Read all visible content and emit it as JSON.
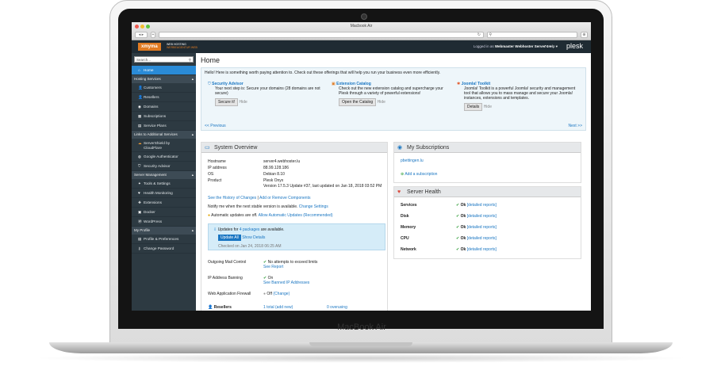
{
  "device": {
    "brand": "MacBook Air",
    "window_title": "Macbook Air"
  },
  "header": {
    "logo": "xmyma",
    "logo_sub1": "WEB HOSTING",
    "logo_sub2": "WERBEAGENTUR WEB",
    "logged_in": "Logged in as",
    "user": "Webmaster Webhoster Server 4",
    "help": "Help",
    "plesk": "plesk"
  },
  "sidebar": {
    "search_placeholder": "Search...",
    "home": "Home",
    "sec1": "Hosting Services",
    "customers": "Customers",
    "resellers": "Resellers",
    "domains": "Domains",
    "subscriptions": "Subscriptions",
    "plans": "Service Plans",
    "sec2": "Links to Additional Services",
    "serv1": "ServerShield by",
    "serv1b": "CloudFlare",
    "gauth": "Google Authenticator",
    "secadv": "Security Advisor",
    "sec3": "Server Management",
    "tools": "Tools & Settings",
    "health": "Health Monitoring",
    "ext": "Extensions",
    "docker": "Docker",
    "wp": "WordPress",
    "sec4": "My Profile",
    "profile": "Profile & Preferences",
    "pass": "Change Password"
  },
  "main": {
    "title": "Home",
    "promo_text": "Hello! Here is something worth paying attention to. Check out these offerings that will help you run your business even more efficiently.",
    "c1t": "Security Advisor",
    "c1d": "Your next step is: Secure your domains (28 domains are not secure)",
    "c1b": "Secure it!",
    "hide": "Hide",
    "c2t": "Extension Catalog",
    "c2d": "Check out the new extension catalog and supercharge your Plesk through a variety of powerful extensions!",
    "c2b": "Open the Catalog",
    "c3t": "Joomla! Toolkit",
    "c3d": "Joomla! Toolkit is a powerful Joomla! security and management tool that allows you to mass manage and secure your Joomla! instances, extensions and templates.",
    "c3b": "Details",
    "prev": "<< Previous",
    "next": "Next >>",
    "so_title": "System Overview",
    "k1": "Hostname",
    "v1": "server4.webhoster.lu",
    "k2": "IP address",
    "v2": "88.99.128.186",
    "k3": "OS",
    "v3": "Debian 8.10",
    "k4": "Product",
    "v4a": "Plesk Onyx",
    "v4b": "Version 17.5.3 Update #37, last updated on Jan 18, 2018 03:52 PM",
    "hist": "See the History of Changes",
    "sep": "|",
    "addrm": "Add or Remove Components",
    "notify": "Notify me when the next stable version is available.",
    "chg": "Change Settings",
    "auto": "Automatic updates are off.",
    "allow": "Allow Automatic Updates (Recommended)",
    "upd_a": "Updates for",
    "upd_b": "4 packages",
    "upd_c": "are available.",
    "upd_btn": "Update All",
    "show": "Show Details",
    "checked": "Checked on Jan 24, 2018 06:25 AM",
    "mail_k": "Outgoing Mail Control",
    "mail_v": "No attempts to exceed limits",
    "mail_l": "See Report",
    "ipb_k": "IP Address Banning",
    "ipb_v": "On",
    "ipb_l": "See Banned IP Addresses",
    "waf_k": "Web Application Firewall",
    "waf_v": "Off",
    "waf_l": "(Change)",
    "res_k": "Resellers",
    "res_v": "1 total",
    "res_l": "(add new)",
    "res_o": "0 overusing",
    "sub_title": "My Subscriptions",
    "sub_link": "pbettingen.lu",
    "sub_add": "Add a subscription",
    "sh_title": "Server Health",
    "ok": "Ok",
    "det": "[detailed reports]",
    "h1": "Services",
    "h2": "Disk",
    "h3": "Memory",
    "h4": "CPU",
    "h5": "Network"
  }
}
